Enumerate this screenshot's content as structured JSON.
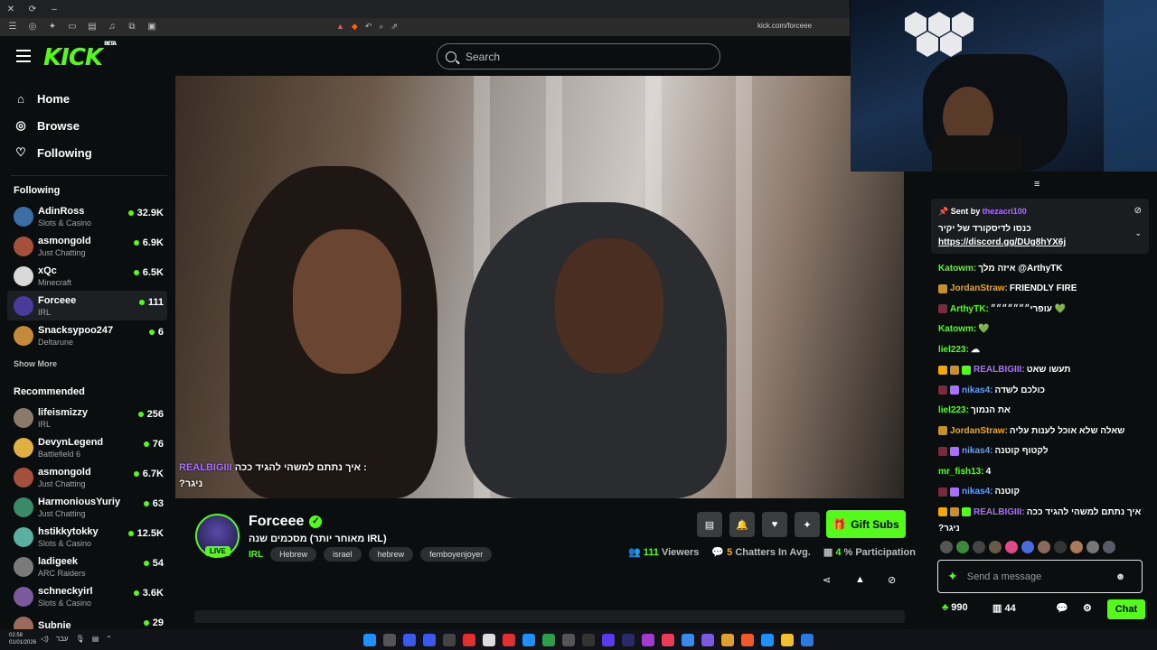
{
  "browser": {
    "url": "kick.com/forceee",
    "window_controls": [
      "✕",
      "⟳",
      "–"
    ]
  },
  "topnav": {
    "logo": "KICK",
    "logo_beta": "BETA",
    "search_placeholder": "Search"
  },
  "sidebar": {
    "nav": [
      {
        "label": "Home",
        "icon": "home-icon"
      },
      {
        "label": "Browse",
        "icon": "compass-icon"
      },
      {
        "label": "Following",
        "icon": "heart-icon"
      }
    ],
    "following_header": "Following",
    "following": [
      {
        "name": "AdinRoss",
        "category": "Slots & Casino",
        "viewers": "32.9K",
        "color": "#3a6ea5"
      },
      {
        "name": "asmongold",
        "category": "Just Chatting",
        "viewers": "6.9K",
        "color": "#a5503a"
      },
      {
        "name": "xQc",
        "category": "Minecraft",
        "viewers": "6.5K",
        "color": "#d8d8d8"
      },
      {
        "name": "Forceee",
        "category": "IRL",
        "viewers": "111",
        "color": "#4a3a9a"
      },
      {
        "name": "Snacksypoo247",
        "category": "Deltarune",
        "viewers": "6",
        "color": "#c48a3a"
      }
    ],
    "show_more": "Show More",
    "recommended_header": "Recommended",
    "recommended": [
      {
        "name": "lifeismizzy",
        "category": "IRL",
        "viewers": "256",
        "color": "#8a7a6a"
      },
      {
        "name": "DevynLegend",
        "category": "Battlefield 6",
        "viewers": "76",
        "color": "#e0b040"
      },
      {
        "name": "asmongold",
        "category": "Just Chatting",
        "viewers": "6.7K",
        "color": "#a5503a"
      },
      {
        "name": "HarmoniousYuriy",
        "category": "Just Chatting",
        "viewers": "63",
        "color": "#3a8a6a"
      },
      {
        "name": "hstikkytokky",
        "category": "Slots & Casino",
        "viewers": "12.5K",
        "color": "#5ab0a0"
      },
      {
        "name": "ladigeek",
        "category": "ARC Raiders",
        "viewers": "54",
        "color": "#7a7a7a"
      },
      {
        "name": "schneckyirl",
        "category": "Slots & Casino",
        "viewers": "3.6K",
        "color": "#7a5a9a"
      },
      {
        "name": "Subnie",
        "category": "",
        "viewers": "29",
        "color": "#9a6a5a"
      }
    ]
  },
  "video_overlay": {
    "name": "REALBIGIII",
    "line1": "איך נתתם למשהי להגיד ככה :",
    "line2": "?ניגר"
  },
  "stream_info": {
    "streamer": "Forceee",
    "live_badge": "LIVE",
    "title": "מאוחר יותר) מסכמים שנה IRL)",
    "category": "IRL",
    "tags": [
      "Hebrew",
      "israel",
      "hebrew",
      "femboyenjoyer"
    ],
    "gift_label": "Gift Subs",
    "viewers": "111",
    "viewers_label": "Viewers",
    "chatters": "5",
    "chatters_label": "Chatters In Avg.",
    "participation": "4",
    "participation_label": "% Participation"
  },
  "chat": {
    "pinned_sent_by": "Sent by",
    "pinned_user": "thezacri100",
    "pinned_text": "כנסו לדיסקורד של יקיר",
    "pinned_link": "https://discord.gg/DUg8hYX6j",
    "messages": [
      {
        "user": "Katowm",
        "color": "#53fc18",
        "text": "איזה מלך @ArthyTK",
        "badges": []
      },
      {
        "user": "JordanStraw",
        "color": "#f7a600",
        "text": "FRIENDLY FIRE",
        "badges": [
          "#c8902a"
        ]
      },
      {
        "user": "ArthyTK",
        "color": "#53fc18",
        "text": "עופרי״״״״״״״ 💚",
        "badges": [
          "#7a2a3a"
        ]
      },
      {
        "user": "Katowm",
        "color": "#53fc18",
        "text": "💚",
        "badges": []
      },
      {
        "user": "liel223",
        "color": "#53fc18",
        "text": "☁",
        "badges": []
      },
      {
        "user": "REALBIGIII",
        "color": "#a970ff",
        "text": "תעשו שאט",
        "badges": [
          "#f7a600",
          "#c8902a",
          "#53fc18"
        ]
      },
      {
        "user": "nikas4",
        "color": "#5aa0ff",
        "text": "כולכם לשדה",
        "badges": [
          "#7a2a3a",
          "#a970ff"
        ]
      },
      {
        "user": "liel223",
        "color": "#53fc18",
        "text": "את הנמוך",
        "badges": []
      },
      {
        "user": "JordanStraw",
        "color": "#f7a600",
        "text": "שאלה שלא אוכל לענות עליה",
        "badges": [
          "#c8902a"
        ]
      },
      {
        "user": "nikas4",
        "color": "#5aa0ff",
        "text": "לקטוף קוטנה",
        "badges": [
          "#7a2a3a",
          "#a970ff"
        ]
      },
      {
        "user": "mr_fish13",
        "color": "#53fc18",
        "text": "4",
        "badges": []
      },
      {
        "user": "nikas4",
        "color": "#5aa0ff",
        "text": "קוטנה",
        "badges": [
          "#7a2a3a",
          "#a970ff"
        ]
      },
      {
        "user": "REALBIGIII",
        "color": "#a970ff",
        "text": "איך נתתם למשהי להגיד ככה",
        "badges": [
          "#f7a600",
          "#c8902a",
          "#53fc18"
        ]
      }
    ],
    "last_msg_cont": "?ניגר",
    "input_placeholder": "Send a message",
    "points": "990",
    "subs": "44",
    "chat_button": "Chat"
  },
  "taskbar": {
    "time": "02:58",
    "date": "01/01/2026",
    "lang": "עבר"
  }
}
